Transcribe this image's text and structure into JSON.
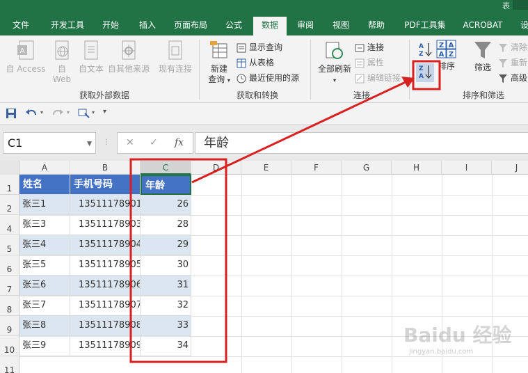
{
  "title_fragment": "表",
  "tabs": [
    {
      "label": "文件",
      "active": false
    },
    {
      "label": "开发工具",
      "active": false
    },
    {
      "label": "开始",
      "active": false
    },
    {
      "label": "插入",
      "active": false
    },
    {
      "label": "页面布局",
      "active": false
    },
    {
      "label": "公式",
      "active": false
    },
    {
      "label": "数据",
      "active": true
    },
    {
      "label": "审阅",
      "active": false
    },
    {
      "label": "视图",
      "active": false
    },
    {
      "label": "帮助",
      "active": false
    },
    {
      "label": "PDF工具集",
      "active": false
    },
    {
      "label": "ACROBAT",
      "active": false
    },
    {
      "label": "设",
      "active": false
    }
  ],
  "ribbon": {
    "get_external": {
      "group_label": "获取外部数据",
      "access": "自 Access",
      "web_top": "自",
      "web_bottom": "Web",
      "text": "自文本",
      "other": "自其他来源",
      "existing": "现有连接"
    },
    "get_transform": {
      "group_label": "获取和转换",
      "new_query_top": "新建",
      "new_query_bottom": "查询",
      "show_queries": "显示查询",
      "from_table": "从表格",
      "recent_sources": "最近使用的源"
    },
    "connections": {
      "group_label": "连接",
      "refresh_all": "全部刷新",
      "connections": "连接",
      "properties": "属性",
      "edit_links": "编辑链接"
    },
    "sort_filter": {
      "group_label": "排序和筛选",
      "sort": "排序",
      "filter": "筛选",
      "clear": "清除",
      "reapply": "重新",
      "advanced": "高级",
      "sort_az_icon": "sort-ascending-icon",
      "sort_za_icon": "sort-descending-icon"
    }
  },
  "formula_bar": {
    "name_box": "C1",
    "formula": "年龄",
    "cancel": "✕",
    "enter": "✓",
    "fx": "fx"
  },
  "columns": [
    "A",
    "B",
    "C",
    "D",
    "E",
    "F",
    "G",
    "H",
    "I",
    "J"
  ],
  "rows": [
    "1",
    "2",
    "4",
    "5",
    "6",
    "7",
    "8",
    "9",
    "10",
    "11"
  ],
  "table": {
    "headers": [
      "姓名",
      "手机号码",
      "年龄"
    ],
    "data": [
      [
        "张三1",
        "13511178901",
        "26"
      ],
      [
        "张三3",
        "13511178903",
        "28"
      ],
      [
        "张三4",
        "13511178904",
        "29"
      ],
      [
        "张三5",
        "13511178905",
        "30"
      ],
      [
        "张三6",
        "13511178906",
        "31"
      ],
      [
        "张三7",
        "13511178907",
        "32"
      ],
      [
        "张三8",
        "13511178908",
        "33"
      ],
      [
        "张三9",
        "13511178909",
        "34"
      ]
    ]
  },
  "watermark": {
    "brand": "Baidu 经验",
    "url": "jingyan.baidu.com"
  },
  "colors": {
    "ribbon_green": "#217346",
    "header_blue": "#4472c4",
    "band_blue": "#dce6f1",
    "annotation_red": "#d92020"
  }
}
